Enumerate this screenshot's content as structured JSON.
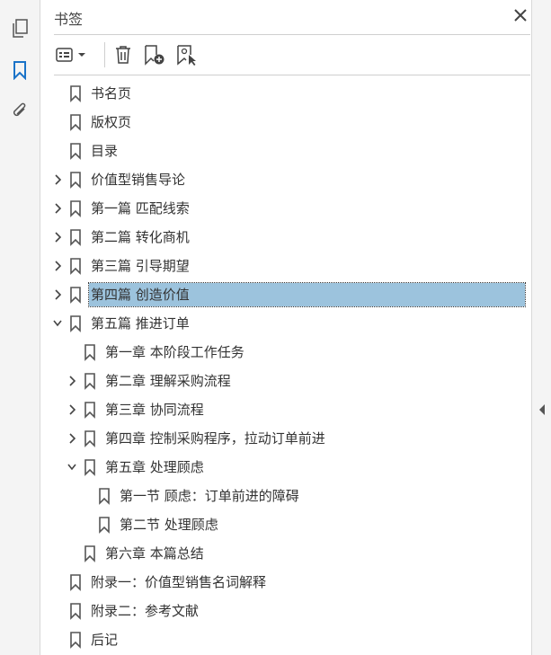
{
  "panel": {
    "title": "书签"
  },
  "rail": {
    "items": [
      {
        "name": "pages-icon"
      },
      {
        "name": "bookmark-icon"
      },
      {
        "name": "attachment-icon"
      }
    ]
  },
  "colors": {
    "accent": "#1a73c8",
    "selection": "#9cc3dd"
  },
  "tree": [
    {
      "label": "书名页",
      "level": 0,
      "chevron": "none"
    },
    {
      "label": "版权页",
      "level": 0,
      "chevron": "none"
    },
    {
      "label": "目录",
      "level": 0,
      "chevron": "none"
    },
    {
      "label": "价值型销售导论",
      "level": 0,
      "chevron": "right"
    },
    {
      "label": "第一篇 匹配线索",
      "level": 0,
      "chevron": "right"
    },
    {
      "label": "第二篇 转化商机",
      "level": 0,
      "chevron": "right"
    },
    {
      "label": "第三篇 引导期望",
      "level": 0,
      "chevron": "right"
    },
    {
      "label": "第四篇 创造价值",
      "level": 0,
      "chevron": "right",
      "selected": true
    },
    {
      "label": "第五篇 推进订单",
      "level": 0,
      "chevron": "down"
    },
    {
      "label": "第一章 本阶段工作任务",
      "level": 1,
      "chevron": "none"
    },
    {
      "label": "第二章 理解采购流程",
      "level": 1,
      "chevron": "right"
    },
    {
      "label": "第三章 协同流程",
      "level": 1,
      "chevron": "right"
    },
    {
      "label": "第四章 控制采购程序，拉动订单前进",
      "level": 1,
      "chevron": "right"
    },
    {
      "label": "第五章 处理顾虑",
      "level": 1,
      "chevron": "down"
    },
    {
      "label": "第一节 顾虑：订单前进的障碍",
      "level": 2,
      "chevron": "none"
    },
    {
      "label": "第二节 处理顾虑",
      "level": 2,
      "chevron": "none"
    },
    {
      "label": "第六章 本篇总结",
      "level": 1,
      "chevron": "none"
    },
    {
      "label": "附录一：价值型销售名词解释",
      "level": 0,
      "chevron": "none"
    },
    {
      "label": "附录二：参考文献",
      "level": 0,
      "chevron": "none"
    },
    {
      "label": "后记",
      "level": 0,
      "chevron": "none"
    }
  ]
}
